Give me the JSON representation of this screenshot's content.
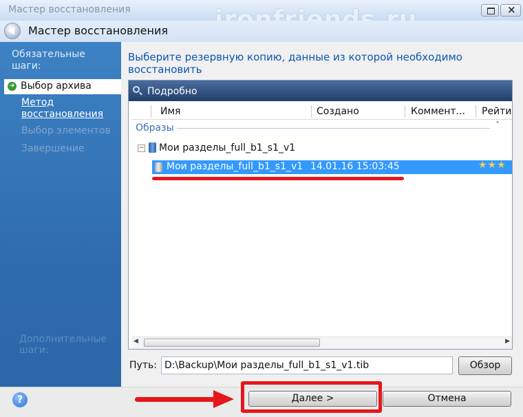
{
  "window": {
    "title": "Мастер восстановления",
    "watermark": "ironfriends.ru"
  },
  "header": {
    "title": "Мастер восстановления"
  },
  "sidebar": {
    "heading": "Обязательные шаги:",
    "current_step": "Выбор архива",
    "link_step": "Метод восстановления",
    "disabled_steps": [
      "Выбор элементов",
      "Завершение"
    ],
    "extra_heading": "Дополнительные шаги:"
  },
  "main": {
    "prompt": "Выберите резервную копию, данные из которой необходимо восстановить",
    "panel_title": "Подробно",
    "columns": [
      "Имя",
      "Создано",
      "Коммент...",
      "Рейти"
    ],
    "group_label": "Образы",
    "tree_parent": "Мои разделы_full_b1_s1_v1",
    "selected_item": {
      "name": "Мои разделы_full_b1_s1_v1",
      "created": "14.01.16 15:03:45",
      "rating": "★★★"
    }
  },
  "path": {
    "label": "Путь:",
    "value": "D:\\Backup\\Мои разделы_full_b1_s1_v1.tib",
    "browse_label": "Обзор"
  },
  "footer": {
    "help_label": "?",
    "next_label": "Далее >",
    "cancel_label": "Отмена"
  },
  "colors": {
    "accent": "#3399ff",
    "sidebar": "#2f6db0",
    "annotation": "#e6161c",
    "prompt": "#0b56b3"
  }
}
